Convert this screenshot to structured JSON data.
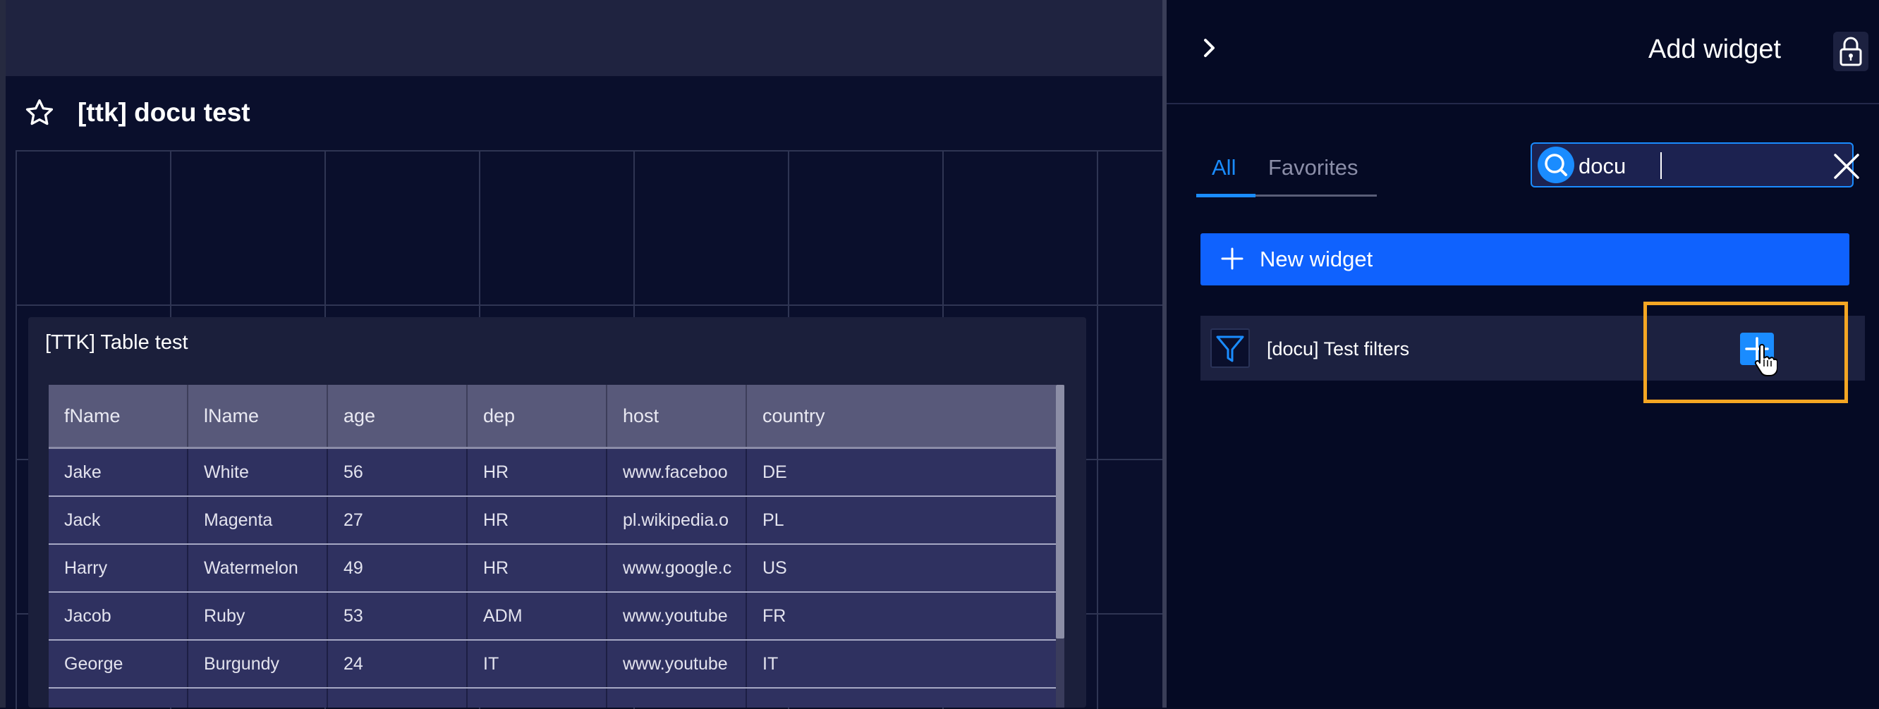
{
  "dashboard": {
    "title": "[ttk] docu test"
  },
  "widget": {
    "title": "[TTK] Table test",
    "columns": [
      "fName",
      "lName",
      "age",
      "dep",
      "host",
      "country"
    ],
    "rows": [
      [
        "Jake",
        "White",
        "56",
        "HR",
        "www.faceboo",
        "DE"
      ],
      [
        "Jack",
        "Magenta",
        "27",
        "HR",
        "pl.wikipedia.o",
        "PL"
      ],
      [
        "Harry",
        "Watermelon",
        "49",
        "HR",
        "www.google.c",
        "US"
      ],
      [
        "Jacob",
        "Ruby",
        "53",
        "ADM",
        "www.youtube",
        "FR"
      ],
      [
        "George",
        "Burgundy",
        "24",
        "IT",
        "www.youtube",
        "IT"
      ]
    ]
  },
  "panel": {
    "title": "Add widget",
    "tabs": [
      {
        "label": "All",
        "active": true
      },
      {
        "label": "Favorites",
        "active": false
      }
    ],
    "search": {
      "value": "docu",
      "placeholder": ""
    },
    "new_widget_label": "New widget",
    "results": [
      {
        "label": "[docu] Test filters",
        "icon": "filter-icon"
      }
    ]
  },
  "colors": {
    "accent": "#1a8cff",
    "primary_button": "#0f62fe",
    "highlight": "#f5a623",
    "background": "#050a24"
  }
}
